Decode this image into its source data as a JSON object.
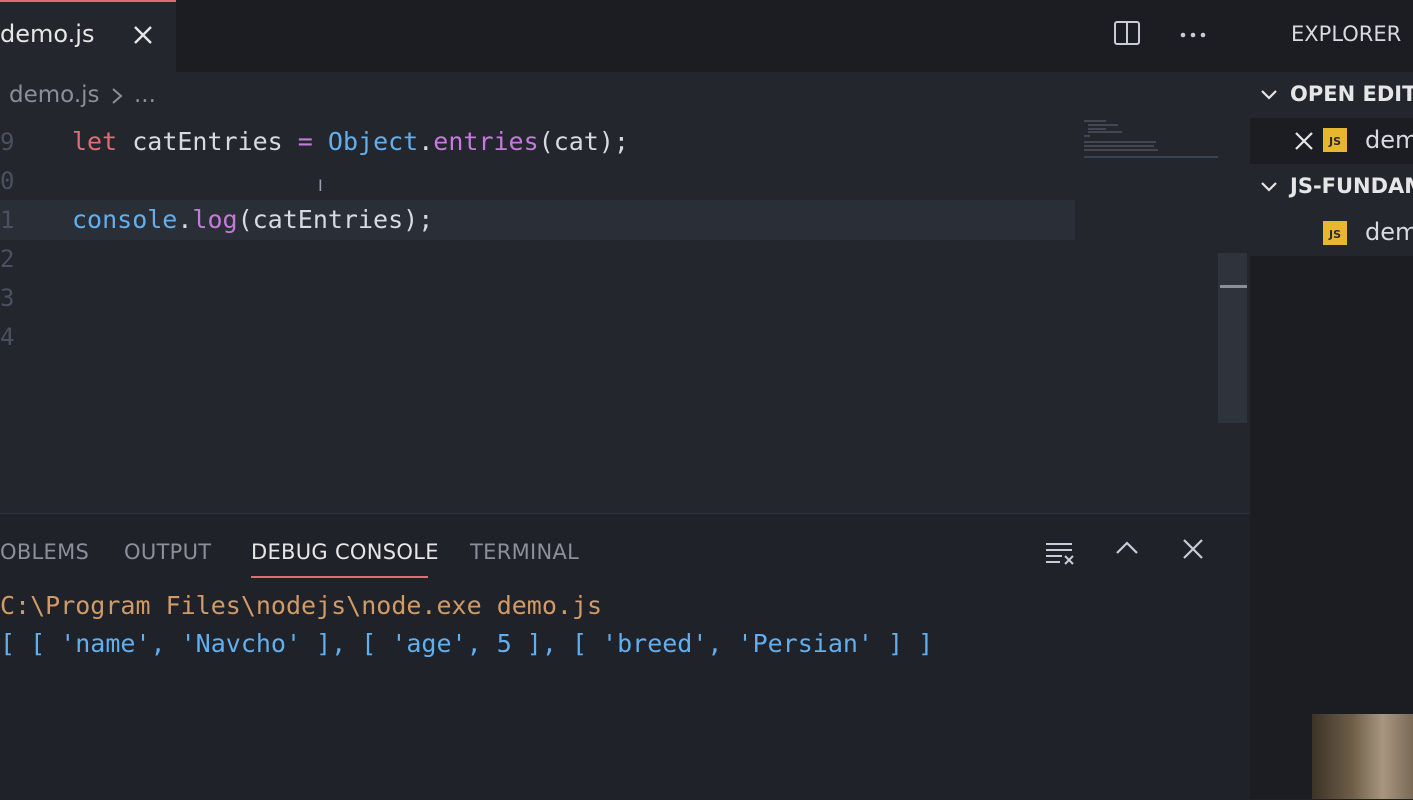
{
  "editor": {
    "tab": {
      "label": "demo.js"
    },
    "breadcrumb": {
      "file": "demo.js",
      "more": "..."
    },
    "line_numbers": [
      "9",
      "0",
      "1",
      "2",
      "3",
      "4"
    ],
    "code": {
      "line1": {
        "kw": "let",
        "name": "catEntries",
        "op": "=",
        "cls": "Object",
        "dot": ".",
        "fn": "entries",
        "rest": "(cat);"
      },
      "line3": {
        "obj": "console",
        "dot": ".",
        "fn": "log",
        "rest": "(catEntries);"
      }
    }
  },
  "panel": {
    "tabs": [
      "OBLEMS",
      "OUTPUT",
      "DEBUG CONSOLE",
      "TERMINAL"
    ],
    "active_tab": "DEBUG CONSOLE",
    "console": {
      "command": "C:\\Program Files\\nodejs\\node.exe demo.js",
      "output": "[ [ 'name', 'Navcho' ], [ 'age', 5 ], [ 'breed', 'Persian' ] ]"
    }
  },
  "explorer": {
    "title": "EXPLORER",
    "open_editors": {
      "label": "OPEN EDITO",
      "item": {
        "badge": "JS",
        "label": "dem"
      }
    },
    "folder": {
      "label": "JS-FUNDAM",
      "item": {
        "badge": "JS",
        "label": "dem"
      }
    }
  },
  "colors": {
    "accent": "#e06c75",
    "console_command": "#d19a66",
    "console_output": "#61afef",
    "js_badge": "#e8b730"
  },
  "icons": [
    "close-icon",
    "split-editor-icon",
    "more-actions-icon",
    "chevron-right-icon",
    "clear-console-icon",
    "maximize-panel-icon",
    "close-panel-icon",
    "chevron-down-icon"
  ]
}
